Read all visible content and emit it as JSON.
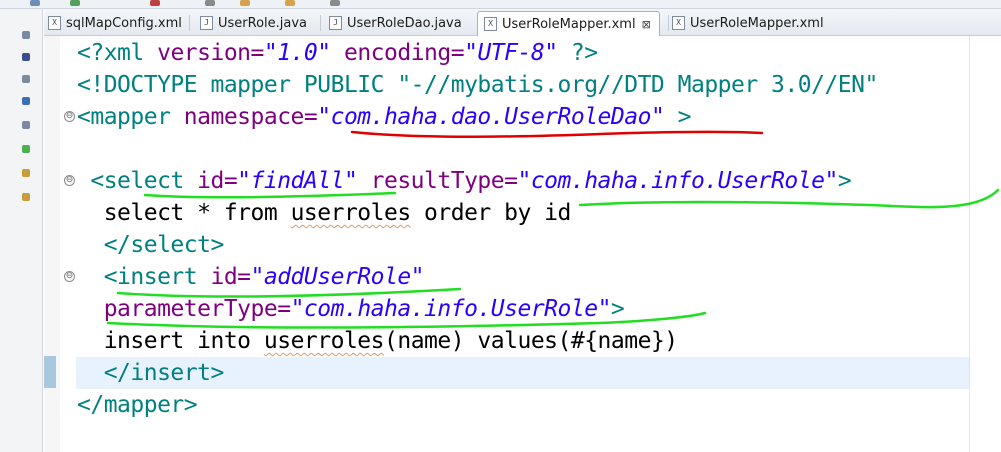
{
  "tabs": [
    {
      "name": "sqlMapConfig.xml",
      "icon": "xml-file-icon",
      "active": false
    },
    {
      "name": "UserRole.java",
      "icon": "java-file-icon",
      "active": false
    },
    {
      "name": "UserRoleDao.java",
      "icon": "java-file-icon",
      "active": false
    },
    {
      "name": "UserRoleMapper.xml",
      "icon": "xml-file-icon",
      "active": true
    },
    {
      "name": "UserRoleMapper.xml",
      "icon": "xml-file-icon",
      "active": false
    }
  ],
  "tab_glyphs": {
    "xml": "X",
    "java": "J",
    "close": "⊠"
  },
  "fold_glyph": "⊖",
  "code": {
    "line1": {
      "open": "<?xml",
      "a1": " version=",
      "v1": "\"1.0\"",
      "a2": " encoding=",
      "v2": "\"UTF-8\"",
      "close": " ?>"
    },
    "line2": {
      "text": "<!DOCTYPE mapper PUBLIC \"-//mybatis.org//DTD Mapper 3.0//EN\""
    },
    "line3": {
      "open": "<mapper",
      "a1": " namespace=",
      "v1": "\"com.haha.dao.UserRoleDao\"",
      "close": " >"
    },
    "line4": {
      "open": " <select",
      "a1": " id=",
      "v1": "\"findAll\"",
      "a2": " resultType=",
      "v2": "\"com.haha.info.UserRole\"",
      "close": ">"
    },
    "line5": {
      "pre": "  select * from ",
      "sq": "userroles",
      "post": " order by id"
    },
    "line6": {
      "text": "  </select>"
    },
    "line7": {
      "open": "  <insert",
      "a1": " id=",
      "v1": "\"addUserRole\""
    },
    "line8": {
      "pre": "  ",
      "a1": "parameterType=",
      "v1": "\"com.haha.info.UserRole\"",
      "close": ">"
    },
    "line9": {
      "pre": "  insert into ",
      "sq": "userroles",
      "post": "(name) values(#{name})"
    },
    "line10": {
      "text": "  </insert>"
    },
    "line11": {
      "text": "</mapper>"
    }
  },
  "colors": {
    "tag": "#008080",
    "attribute": "#7f007f",
    "value": "#2a00ff",
    "current_line": "#e8f2fe",
    "red_annotation": "#e00000",
    "green_annotation": "#22dd22"
  }
}
